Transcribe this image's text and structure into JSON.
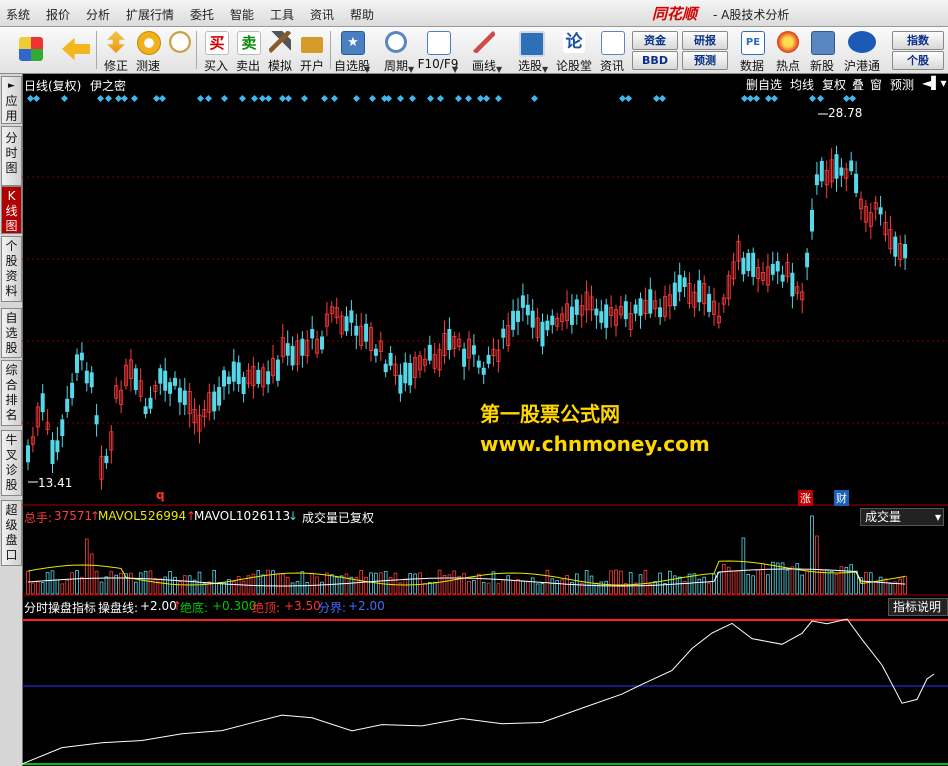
{
  "menu": [
    "系统",
    "报价",
    "分析",
    "扩展行情",
    "委托",
    "智能",
    "工具",
    "资讯",
    "帮助"
  ],
  "logo": "同花顺",
  "window_title": "- A股技术分析",
  "toolbar": {
    "buttons": [
      {
        "label": "",
        "icon": "grid-icon"
      },
      {
        "label": "",
        "icon": "back-arrow-icon"
      },
      {
        "label": "修正",
        "icon": "updown-arrows-icon"
      },
      {
        "label": "测速",
        "icon": "speed-icon"
      },
      {
        "label": "买入",
        "icon": "buy-icon",
        "glyph": "买"
      },
      {
        "label": "卖出",
        "icon": "sell-icon",
        "glyph": "卖"
      },
      {
        "label": "模拟",
        "icon": "hammer-icon"
      },
      {
        "label": "开户",
        "icon": "lock-icon"
      },
      {
        "label": "自选股",
        "icon": "star-icon"
      },
      {
        "label": "周期",
        "icon": "clock-icon"
      },
      {
        "label": "F10/F9",
        "icon": "document-icon"
      },
      {
        "label": "画线",
        "icon": "pencil-icon"
      },
      {
        "label": "选股",
        "icon": "screen-icon"
      },
      {
        "label": "论股堂",
        "icon": "discuss-icon",
        "glyph": "论"
      },
      {
        "label": "资讯",
        "icon": "news-icon"
      },
      {
        "label": "数据",
        "icon": "pe-icon",
        "glyph": "PE"
      },
      {
        "label": "热点",
        "icon": "hot-icon"
      },
      {
        "label": "新股",
        "icon": "newstock-icon"
      },
      {
        "label": "沪港通",
        "icon": "hk-icon"
      }
    ],
    "small_buttons": [
      "资金",
      "BBD",
      "研报",
      "预测",
      "指数",
      "个股"
    ]
  },
  "sidebar_tabs": [
    {
      "label": "应用",
      "prefix": "►"
    },
    {
      "label": "分时图"
    },
    {
      "label": "K线图",
      "active": true
    },
    {
      "label": "个股资料"
    },
    {
      "label": "自选股"
    },
    {
      "label": "综合排名"
    },
    {
      "label": "牛叉诊股"
    },
    {
      "label": "超级盘口"
    }
  ],
  "kline": {
    "period_label": "日线(复权)",
    "stock_name": "伊之密",
    "high_label": "28.78",
    "low_label": "13.41",
    "controls": [
      "删自选",
      "均线",
      "复权",
      "叠",
      "窗",
      "预测"
    ],
    "markers": [
      "q",
      "涨",
      "财"
    ]
  },
  "volume": {
    "total_label": "总手:",
    "total_value": "37571",
    "mavol5_label": "MAVOL5:",
    "mavol5_value": "26994",
    "mavol10_label": "MAVOL10:",
    "mavol10_value": "26113",
    "note": "成交量已复权",
    "selector": "成交量"
  },
  "indicator": {
    "name": "分时操盘指标",
    "line_label": "操盘线:",
    "line_value": "+2.00",
    "bottom_label": "绝底:",
    "bottom_value": "+0.300",
    "top_label": "绝顶:",
    "top_value": "+3.50",
    "div_label": "分界:",
    "div_value": "+2.00",
    "help_button": "指标说明"
  },
  "watermark": {
    "line1": "第一股票公式网",
    "line2": "www.chnmoney.com"
  },
  "colors": {
    "up": "#ff3c3c",
    "down": "#55d8e8",
    "grid": "#7a0000",
    "mavol5": "#e8e800",
    "indicator_line": "#ffffff",
    "top_line": "#ff2020",
    "div_line": "#3030ff",
    "bottom_line": "#00c000"
  }
}
